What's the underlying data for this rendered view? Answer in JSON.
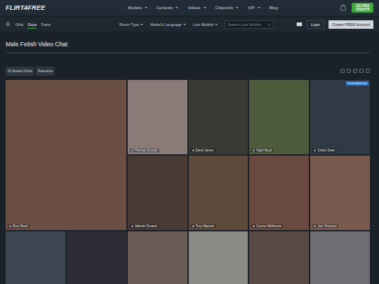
{
  "logo": "FLIRT4FREE",
  "nav": [
    {
      "label": "Models",
      "dropdown": true
    },
    {
      "label": "Contests",
      "dropdown": true
    },
    {
      "label": "Videos",
      "dropdown": true
    },
    {
      "label": "Channels",
      "dropdown": true
    },
    {
      "label": "VIP",
      "dropdown": true
    },
    {
      "label": "Blog",
      "dropdown": false
    }
  ],
  "credits": [
    "120 FREE",
    "CREDITS"
  ],
  "menu_glyph": "☰",
  "gender_tabs": [
    {
      "label": "Girls",
      "selected": false
    },
    {
      "label": "Guys",
      "selected": true
    },
    {
      "label": "Trans",
      "selected": false
    }
  ],
  "filters": [
    "Room Type",
    "Model's Language",
    "Live Models"
  ],
  "search": {
    "placeholder": "Search Live Models"
  },
  "login": "Login",
  "signup": "Create FREE Account",
  "title": "Male Fetish Video Chat",
  "toolbar": {
    "count": "62 Models Online",
    "sort": "Relevance"
  },
  "cards": [
    {
      "name": "Rory Reed",
      "big": true,
      "badge": ""
    },
    {
      "name": "Thomas Duncan",
      "big": false,
      "badge": ""
    },
    {
      "name": "David James",
      "big": false,
      "badge": ""
    },
    {
      "name": "Night Boyd",
      "big": false,
      "badge": ""
    },
    {
      "name": "Charly Dean",
      "big": false,
      "badge": "Private Multi User"
    },
    {
      "name": "Valentin Durand",
      "big": false,
      "badge": ""
    },
    {
      "name": "Tony Marston",
      "big": false,
      "badge": ""
    },
    {
      "name": "Connor McKenzie",
      "big": false,
      "badge": ""
    },
    {
      "name": "Joel Jhonston",
      "big": false,
      "badge": ""
    },
    {
      "name": "",
      "big": false,
      "badge": ""
    },
    {
      "name": "",
      "big": false,
      "badge": ""
    },
    {
      "name": "",
      "big": false,
      "badge": ""
    },
    {
      "name": "",
      "big": false,
      "badge": ""
    },
    {
      "name": "",
      "big": false,
      "badge": ""
    },
    {
      "name": "",
      "big": false,
      "badge": ""
    }
  ]
}
